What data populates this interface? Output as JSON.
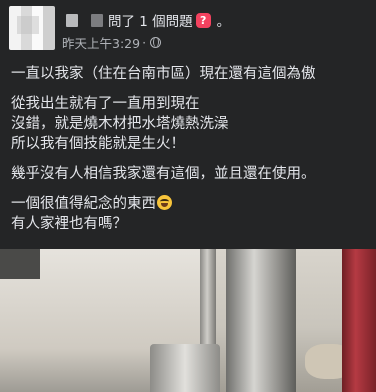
{
  "header": {
    "question_text": "問了 1 個問題",
    "question_badge": "?",
    "separator": "。",
    "timestamp": "昨天上午3:29",
    "dot": "·",
    "privacy_icon": "globe-icon"
  },
  "post": {
    "paragraphs": [
      [
        "一直以我家（住在台南市區）現在還有這個為傲"
      ],
      [
        "從我出生就有了一直用到現在",
        "沒錯，就是燒木材把水塔燒熱洗澡",
        "所以我有個技能就是生火！"
      ],
      [
        "幾乎沒有人相信我家還有這個，並且還在使用。"
      ],
      [
        "一個很值得紀念的東西",
        "有人家裡也有嗎？"
      ]
    ],
    "emoji": "grinning-sweat-emoji"
  },
  "colors": {
    "background": "#242526",
    "text": "#e4e6eb",
    "meta_text": "#b0b3b8",
    "badge": "#f3425f"
  }
}
